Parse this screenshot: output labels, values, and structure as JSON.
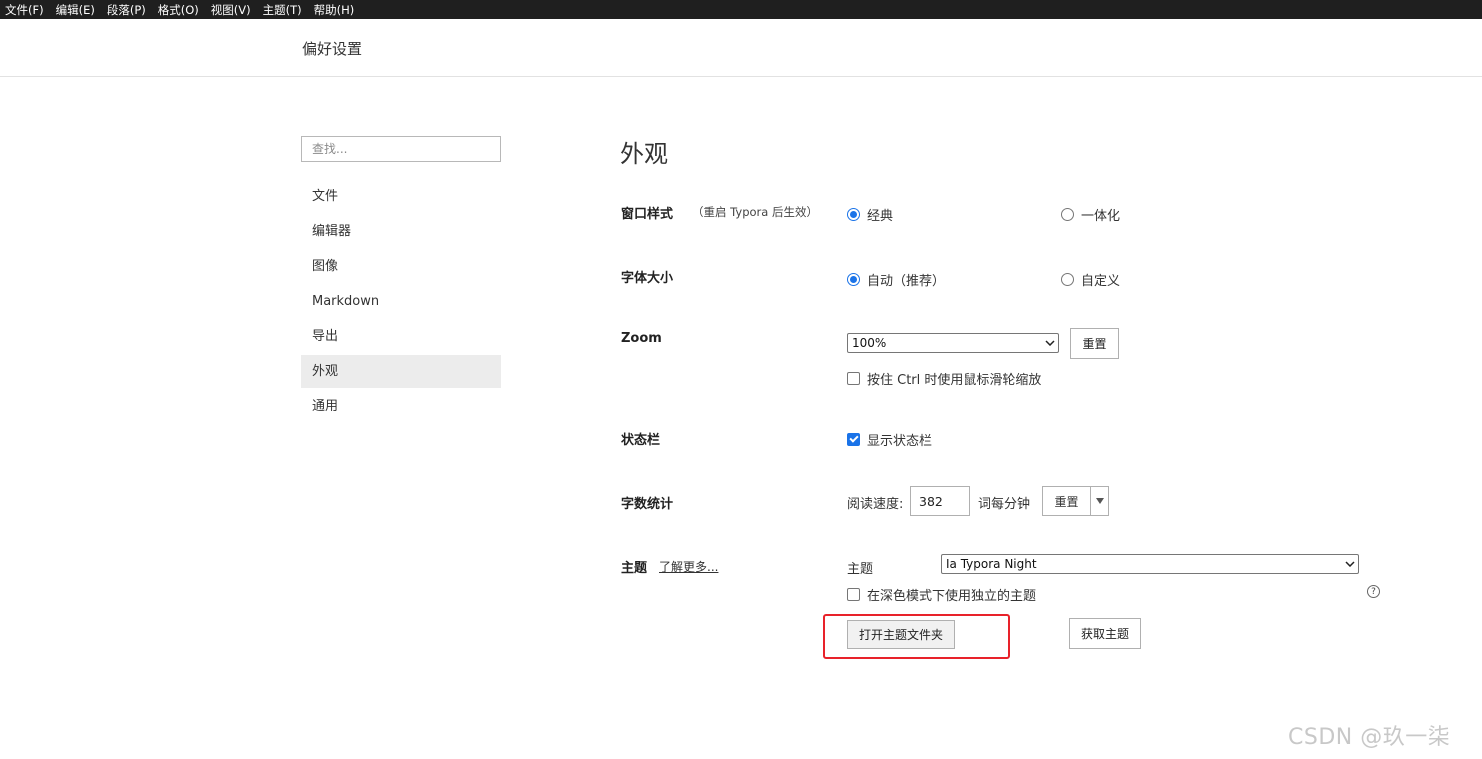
{
  "menubar": {
    "items": [
      "文件(F)",
      "编辑(E)",
      "段落(P)",
      "格式(O)",
      "视图(V)",
      "主题(T)",
      "帮助(H)"
    ]
  },
  "page_title": "偏好设置",
  "search": {
    "placeholder": "查找..."
  },
  "nav": {
    "items": [
      "文件",
      "编辑器",
      "图像",
      "Markdown",
      "导出",
      "外观",
      "通用"
    ],
    "active": "外观"
  },
  "section_title": "外观",
  "window_style": {
    "label": "窗口样式",
    "note": "（重启 Typora 后生效）",
    "options": [
      "经典",
      "一体化"
    ],
    "selected": "经典"
  },
  "font_size": {
    "label": "字体大小",
    "options": [
      "自动（推荐）",
      "自定义"
    ],
    "selected": "自动（推荐）"
  },
  "zoom": {
    "label": "Zoom",
    "value": "100%",
    "reset_label": "重置",
    "ctrl_wheel_label": "按住 Ctrl 时使用鼠标滑轮缩放",
    "ctrl_wheel_checked": false
  },
  "status_bar": {
    "label": "状态栏",
    "show_label": "显示状态栏",
    "checked": true
  },
  "word_count": {
    "label": "字数统计",
    "reading_speed_label": "阅读速度:",
    "reading_speed_value": "382",
    "unit": "词每分钟",
    "reset_label": "重置"
  },
  "theme": {
    "label": "主题",
    "learn_more": "了解更多...",
    "select_label": "主题",
    "value": "Ia Typora Night",
    "dark_mode_label": "在深色模式下使用独立的主题",
    "dark_mode_checked": false,
    "help_icon_text": "?",
    "open_folder_label": "打开主题文件夹",
    "get_themes_label": "获取主题"
  },
  "colors": {
    "accent": "#1a73e8",
    "highlight_box": "#e8222a",
    "menubar_bg": "#1f1f1f"
  },
  "watermark": "CSDN @玖一柒"
}
